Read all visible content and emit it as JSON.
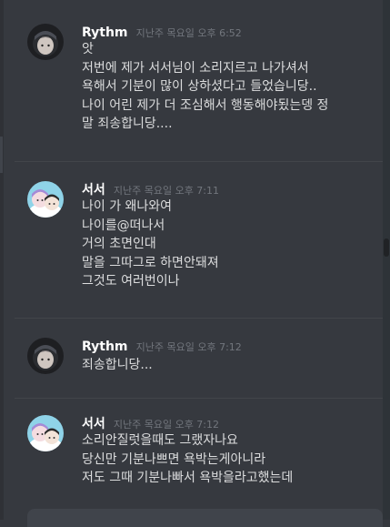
{
  "messages": [
    {
      "author": "Rythm",
      "timestamp": "지난주 목요일 오후 6:52",
      "lines": [
        "앗",
        "저번에 제가 서서님이 소리지르고 나가셔서",
        "욕해서 기분이 많이 상하셨다고 들었습니당..",
        "나이 어린 제가  더 조심해서 행동해야됬는뎅 정",
        "말 죄송합니당...."
      ]
    },
    {
      "author": "서서",
      "timestamp": "지난주 목요일 오후 7:11",
      "lines": [
        "나이 가 왜나와여",
        "나이를@떠나서",
        "거의 초면인대",
        "말을 그따그로 하면안돼져",
        "그것도 여러번이나"
      ]
    },
    {
      "author": "Rythm",
      "timestamp": "지난주 목요일 오후 7:12",
      "lines": [
        "죄송합니당..."
      ]
    },
    {
      "author": "서서",
      "timestamp": "지난주 목요일 오후 7:12",
      "lines": [
        "소리안질럿을때도 그랬자나요",
        "당신만 기분나쁘면 욕박는게아니라",
        "저도 그때 기분나빠서 욕박을라고했는데"
      ]
    }
  ]
}
